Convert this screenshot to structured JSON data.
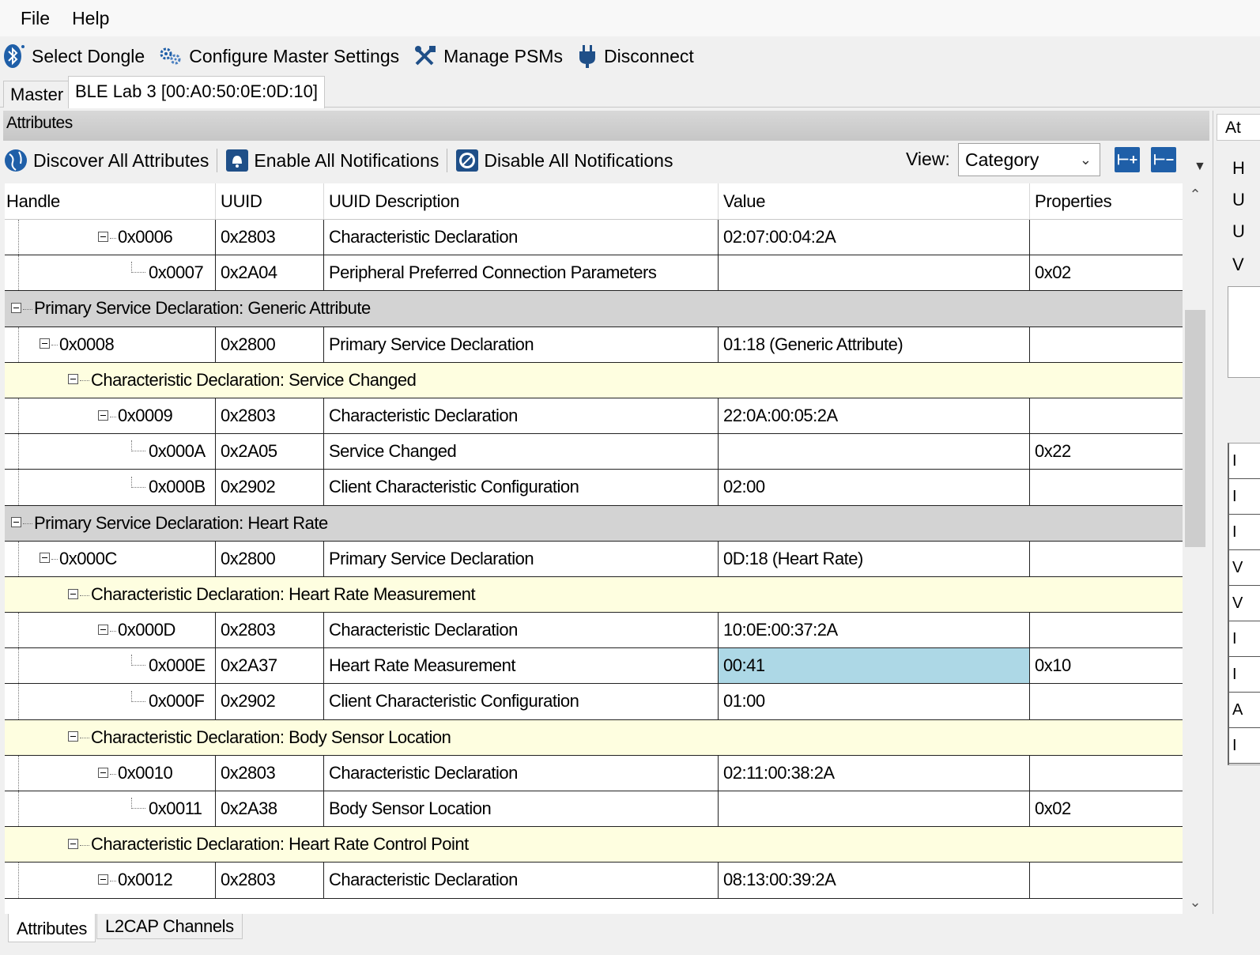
{
  "menu": [
    "File",
    "Help"
  ],
  "toolbar": {
    "select_dongle": "Select Dongle",
    "configure_master": "Configure Master Settings",
    "manage_psms": "Manage PSMs",
    "disconnect": "Disconnect"
  },
  "doc_tabs": {
    "master": "Master",
    "device": "BLE Lab 3 [00:A0:50:0E:0D:10]"
  },
  "attributes_title": "Attributes",
  "attr_toolbar": {
    "discover": "Discover All Attributes",
    "enable": "Enable All Notifications",
    "disable": "Disable All Notifications",
    "view_label": "View:",
    "view_value": "Category"
  },
  "columns": {
    "handle": "Handle",
    "uuid": "UUID",
    "desc": "UUID Description",
    "value": "Value",
    "props": "Properties"
  },
  "rows": [
    {
      "kind": "attr",
      "handle": "0x0006",
      "uuid": "0x2803",
      "desc": "Characteristic Declaration",
      "value": "02:07:00:04:2A",
      "props": ""
    },
    {
      "kind": "attr",
      "handle": "0x0007",
      "uuid": "0x2A04",
      "desc": "Peripheral Preferred Connection Parameters",
      "value": "",
      "props": "0x02"
    },
    {
      "kind": "svc",
      "label": "Primary Service Declaration: Generic Attribute"
    },
    {
      "kind": "attr",
      "handle": "0x0008",
      "uuid": "0x2800",
      "desc": "Primary Service Declaration",
      "value": "01:18 (Generic Attribute)",
      "props": ""
    },
    {
      "kind": "chr",
      "label": "Characteristic Declaration: Service Changed"
    },
    {
      "kind": "attr",
      "handle": "0x0009",
      "uuid": "0x2803",
      "desc": "Characteristic Declaration",
      "value": "22:0A:00:05:2A",
      "props": ""
    },
    {
      "kind": "attr",
      "handle": "0x000A",
      "uuid": "0x2A05",
      "desc": "Service Changed",
      "value": "",
      "props": "0x22"
    },
    {
      "kind": "attr",
      "handle": "0x000B",
      "uuid": "0x2902",
      "desc": "Client Characteristic Configuration",
      "value": "02:00",
      "props": ""
    },
    {
      "kind": "svc",
      "label": "Primary Service Declaration: Heart Rate"
    },
    {
      "kind": "attr",
      "handle": "0x000C",
      "uuid": "0x2800",
      "desc": "Primary Service Declaration",
      "value": "0D:18 (Heart Rate)",
      "props": ""
    },
    {
      "kind": "chr",
      "label": "Characteristic Declaration: Heart Rate Measurement"
    },
    {
      "kind": "attr",
      "handle": "0x000D",
      "uuid": "0x2803",
      "desc": "Characteristic Declaration",
      "value": "10:0E:00:37:2A",
      "props": ""
    },
    {
      "kind": "attr",
      "handle": "0x000E",
      "uuid": "0x2A37",
      "desc": "Heart Rate Measurement",
      "value": "00:41",
      "props": "0x10"
    },
    {
      "kind": "attr",
      "handle": "0x000F",
      "uuid": "0x2902",
      "desc": "Client Characteristic Configuration",
      "value": "01:00",
      "props": ""
    },
    {
      "kind": "chr",
      "label": "Characteristic Declaration: Body Sensor Location"
    },
    {
      "kind": "attr",
      "handle": "0x0010",
      "uuid": "0x2803",
      "desc": "Characteristic Declaration",
      "value": "02:11:00:38:2A",
      "props": ""
    },
    {
      "kind": "attr",
      "handle": "0x0011",
      "uuid": "0x2A38",
      "desc": "Body Sensor Location",
      "value": "",
      "props": "0x02"
    },
    {
      "kind": "chr",
      "label": "Characteristic Declaration: Heart Rate Control Point"
    },
    {
      "kind": "attr",
      "handle": "0x0012",
      "uuid": "0x2803",
      "desc": "Characteristic Declaration",
      "value": "08:13:00:39:2A",
      "props": ""
    }
  ],
  "bottom_tabs": {
    "attributes": "Attributes",
    "l2cap": "L2CAP Channels"
  },
  "right_panel": {
    "tab": "At",
    "labels": [
      "H",
      "U",
      "U",
      "V"
    ],
    "list": [
      "I",
      "I",
      "I",
      "V",
      "V",
      "I",
      "I",
      "A",
      "I"
    ]
  },
  "colors": {
    "service_row": "#d3d3d3",
    "characteristic_row": "#fefee0",
    "selected_cell": "#add8e6",
    "accent": "#1f5fa8"
  },
  "icons": [
    "bluetooth-icon",
    "gears-icon",
    "tools-icon",
    "plug-icon",
    "globe-icon",
    "bell-icon",
    "disable-bell-icon",
    "expand-all-icon",
    "collapse-all-icon"
  ]
}
